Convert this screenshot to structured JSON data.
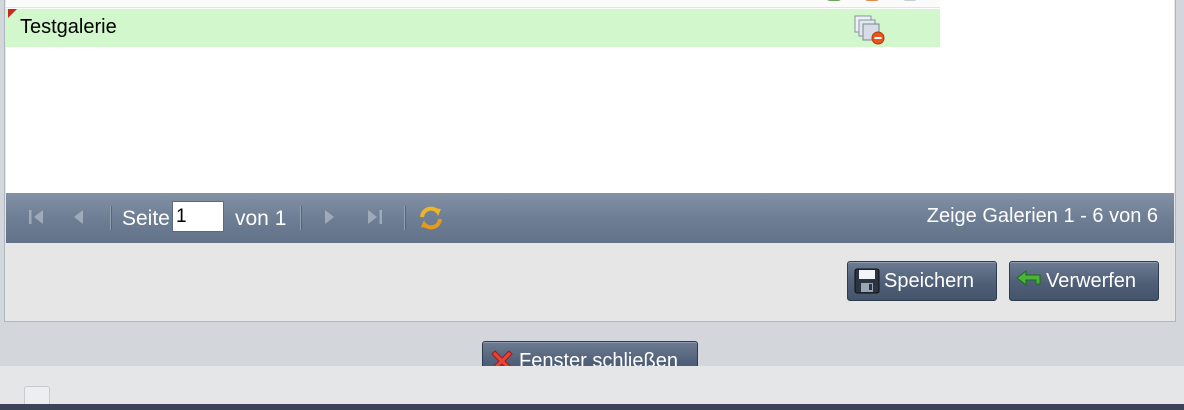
{
  "grid": {
    "rows": [
      {
        "name": "Testgalerie",
        "icon": "gallery-remove-icon"
      }
    ]
  },
  "paging": {
    "page_label": "Seite",
    "page_value": "1",
    "of_label": "von 1",
    "status": "Zeige Galerien 1 - 6 von 6"
  },
  "buttons": {
    "save_label": "Speichern",
    "discard_label": "Verwerfen",
    "close_label": "Fenster schließen"
  },
  "colors": {
    "row_highlight": "#d2f7cc",
    "toolbar": "#6e7e94",
    "button": "#4f5f77"
  }
}
